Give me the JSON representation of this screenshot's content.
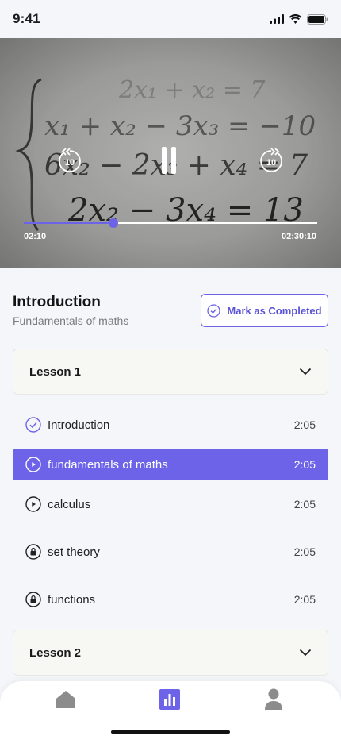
{
  "status_bar": {
    "time": "9:41"
  },
  "video": {
    "skip_back_seconds": "10",
    "skip_forward_seconds": "10",
    "current_time": "02:10",
    "total_time": "02:30:10",
    "progress_fraction": 0.306,
    "accent": "#6c63e8"
  },
  "course": {
    "title": "Introduction",
    "subtitle": "Fundamentals of maths",
    "mark_completed_label": "Mark as Completed"
  },
  "lessons": [
    {
      "title": "Lesson 1",
      "expanded": true,
      "items": [
        {
          "label": "Introduction",
          "duration": "2:05",
          "state": "completed",
          "icon": "check-circle-icon"
        },
        {
          "label": "fundamentals of maths",
          "duration": "2:05",
          "state": "playing",
          "icon": "play-circle-icon"
        },
        {
          "label": "calculus",
          "duration": "2:05",
          "state": "available",
          "icon": "play-circle-icon"
        },
        {
          "label": "set theory",
          "duration": "2:05",
          "state": "locked",
          "icon": "lock-icon"
        },
        {
          "label": "functions",
          "duration": "2:05",
          "state": "locked",
          "icon": "lock-icon"
        }
      ]
    },
    {
      "title": "Lesson 2",
      "expanded": false,
      "items": []
    }
  ],
  "bottom_nav": [
    {
      "icon": "home-icon",
      "active": false
    },
    {
      "icon": "chart-icon",
      "active": true
    },
    {
      "icon": "profile-icon",
      "active": false
    }
  ]
}
